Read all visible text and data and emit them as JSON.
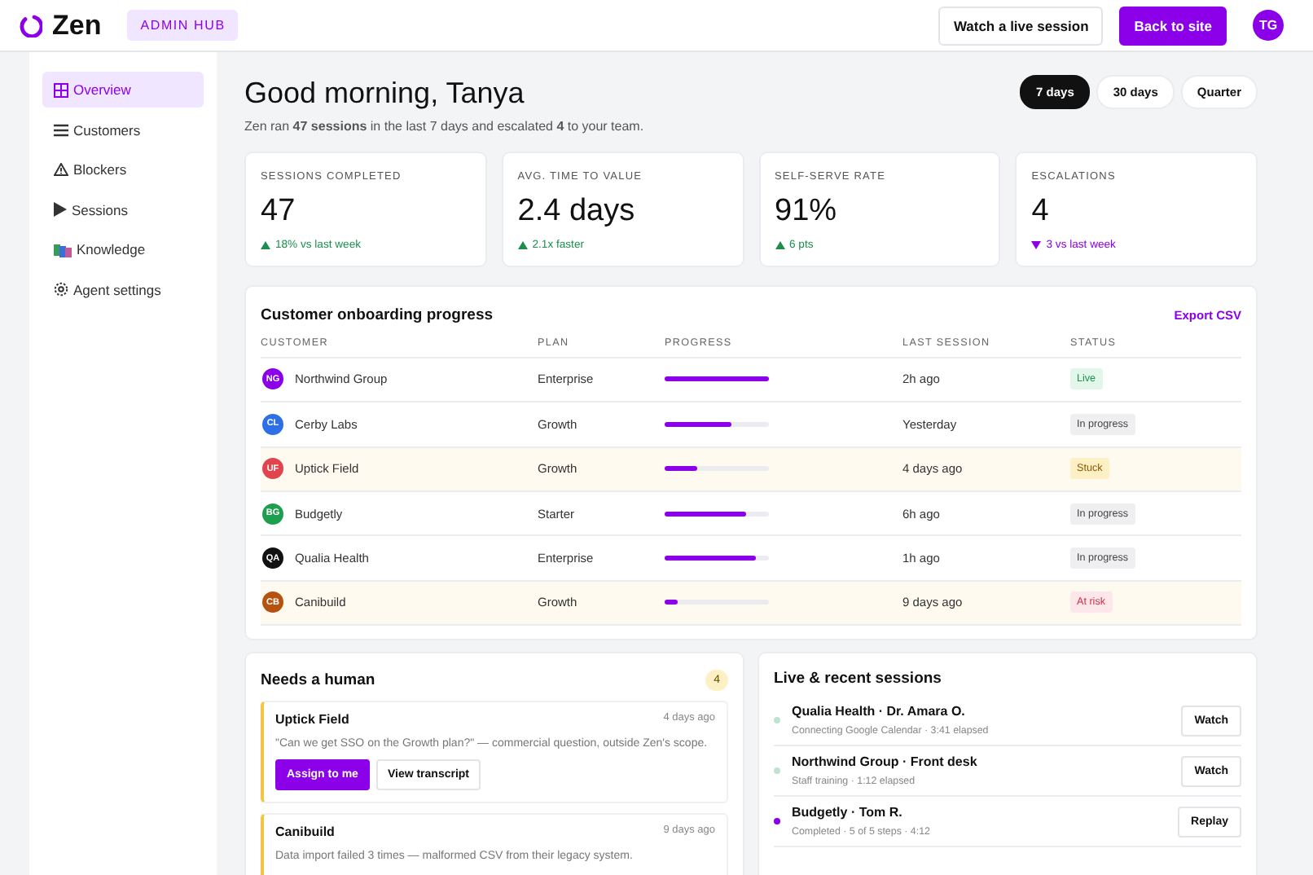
{
  "topbar": {
    "logo": "Zen",
    "badge": "ADMIN HUB",
    "buttons": [
      {
        "label": "Watch a live session",
        "kind": "secondary"
      },
      {
        "label": "Back to site",
        "kind": "primary"
      }
    ],
    "avatar": "TG"
  },
  "sidebar": {
    "items": [
      {
        "label": "Overview",
        "kind": "grid",
        "selected": true
      },
      {
        "label": "Customers",
        "kind": "list",
        "selected": false
      },
      {
        "label": "Blockers",
        "kind": "warning",
        "selected": false
      },
      {
        "label": "Sessions",
        "kind": "play",
        "selected": false
      },
      {
        "label": "Knowledge",
        "kind": "books",
        "selected": false
      },
      {
        "label": "Agent settings",
        "kind": "gear",
        "selected": false
      }
    ]
  },
  "header": {
    "title": "Good morning, Tanya",
    "subtitle": "Zen ran **47 sessions** in the last 7 days and escalated **4** to your team.",
    "ranges": [
      {
        "label": "7 days",
        "selected": true
      },
      {
        "label": "30 days",
        "selected": false
      },
      {
        "label": "Quarter",
        "selected": false
      }
    ]
  },
  "stats": [
    {
      "label": "SESSIONS COMPLETED",
      "value": "47",
      "delta": "18% vs last week",
      "kind": "up"
    },
    {
      "label": "AVG. TIME TO VALUE",
      "value": "2.4 days",
      "delta": "2.1x faster",
      "kind": "up"
    },
    {
      "label": "SELF-SERVE RATE",
      "value": "91%",
      "delta": "6 pts",
      "kind": "up"
    },
    {
      "label": "ESCALATIONS",
      "value": "4",
      "delta": "3 vs last week",
      "kind": "down"
    }
  ],
  "onboarding": {
    "title": "Customer onboarding progress",
    "action": "Export CSV",
    "columns": [
      "CUSTOMER",
      "PLAN",
      "PROGRESS",
      "LAST SESSION",
      "STATUS"
    ],
    "rows": [
      {
        "initials": "NG",
        "color": "#8b00e8",
        "customer": "Northwind Group",
        "plan": "Enterprise",
        "level": 1.0,
        "last_session": "2h ago",
        "status": {
          "label": "Live",
          "kind": "live"
        },
        "flagged": false
      },
      {
        "initials": "CL",
        "color": "#2f6fe6",
        "customer": "Cerby Labs",
        "plan": "Growth",
        "level": 0.64,
        "last_session": "Yesterday",
        "status": {
          "label": "In progress",
          "kind": "progress"
        },
        "flagged": false
      },
      {
        "initials": "UF",
        "color": "#e0454f",
        "customer": "Uptick Field",
        "plan": "Growth",
        "level": 0.31,
        "last_session": "4 days ago",
        "status": {
          "label": "Stuck",
          "kind": "stuck"
        },
        "flagged": true
      },
      {
        "initials": "BG",
        "color": "#1e9e4f",
        "customer": "Budgetly",
        "plan": "Starter",
        "level": 0.78,
        "last_session": "6h ago",
        "status": {
          "label": "In progress",
          "kind": "progress"
        },
        "flagged": false
      },
      {
        "initials": "QA",
        "color": "#111111",
        "customer": "Qualia Health",
        "plan": "Enterprise",
        "level": 0.88,
        "last_session": "1h ago",
        "status": {
          "label": "In progress",
          "kind": "progress"
        },
        "flagged": false
      },
      {
        "initials": "CB",
        "color": "#b5520f",
        "customer": "Canibuild",
        "plan": "Growth",
        "level": 0.12,
        "last_session": "9 days ago",
        "status": {
          "label": "At risk",
          "kind": "risk"
        },
        "flagged": true
      }
    ]
  },
  "needs_human": {
    "title": "Needs a human",
    "count": "4",
    "items": [
      {
        "customer": "Uptick Field",
        "time": "4 days ago",
        "message": "\"Can we get SSO on the Growth plan?\" — commercial question, outside Zen's scope.",
        "actions": [
          {
            "label": "Assign to me",
            "kind": "primary"
          },
          {
            "label": "View transcript",
            "kind": "secondary"
          }
        ]
      },
      {
        "customer": "Canibuild",
        "time": "9 days ago",
        "message": "Data import failed 3 times — malformed CSV from their legacy system."
      }
    ]
  },
  "sessions": {
    "title": "Live & recent sessions",
    "items": [
      {
        "title": "Qualia Health · Dr. Amara O.",
        "detail": "Connecting Google Calendar · 3:41 elapsed",
        "color": "#bfe3cf",
        "action": "Watch"
      },
      {
        "title": "Northwind Group · Front desk",
        "detail": "Staff training · 1:12 elapsed",
        "color": "#bfe3cf",
        "action": "Watch"
      },
      {
        "title": "Budgetly · Tom R.",
        "detail": "Completed · 5 of 5 steps · 4:12",
        "color": "#8b00e8",
        "action": "Replay"
      }
    ]
  }
}
